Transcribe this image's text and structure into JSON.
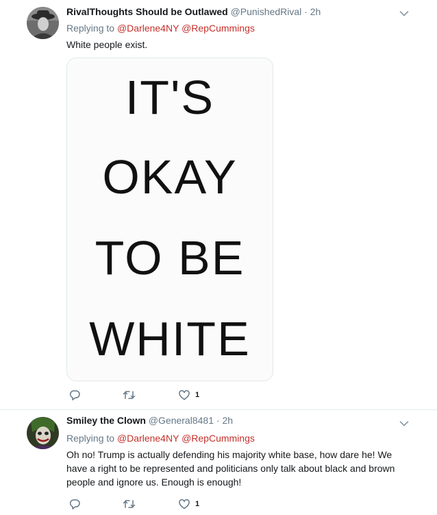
{
  "tweets": [
    {
      "display_name": "RivalThoughts Should be Outlawed",
      "handle": "@PunishedRival",
      "separator": "·",
      "time": "2h",
      "replying_prefix": "Replying to",
      "mentions": [
        "@Darlene4NY",
        "@RepCummings"
      ],
      "text": "White people exist.",
      "image_text": [
        "IT'S",
        "OKAY",
        "TO BE",
        "WHITE"
      ],
      "likes": "1"
    },
    {
      "display_name": "Smiley the Clown",
      "handle": "@General8481",
      "separator": "·",
      "time": "2h",
      "replying_prefix": "Replying to",
      "mentions": [
        "@Darlene4NY",
        "@RepCummings"
      ],
      "text": "Oh no! Trump is actually defending his majority white base, how dare he! We have a right to be represented and politicians only talk about black and brown people and ignore us. Enough is enough!",
      "likes": "1"
    }
  ],
  "colors": {
    "mention": "#c4302b",
    "secondary_text": "#657786",
    "divider": "#e6ecf0"
  },
  "icons": [
    "reply-icon",
    "retweet-icon",
    "like-icon",
    "chevron-down-icon"
  ]
}
